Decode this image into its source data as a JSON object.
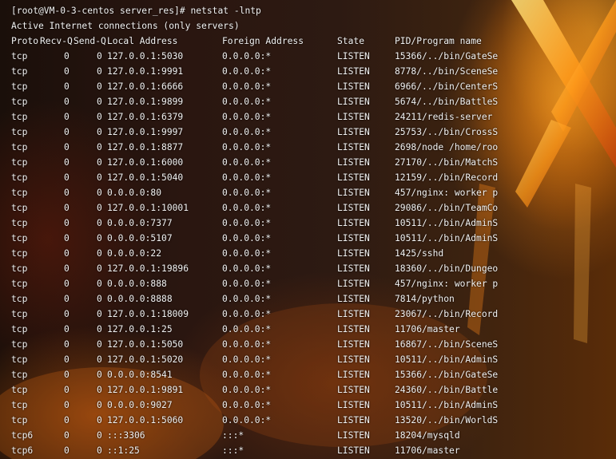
{
  "prompt_line": "[root@VM-0-3-centos server_res]# netstat -lntp",
  "info_line": "Active Internet connections (only servers)",
  "headers": {
    "proto": "Proto",
    "recv": "Recv-Q",
    "send": "Send-Q",
    "local": "Local Address",
    "foreign": "Foreign Address",
    "state": "State",
    "pid": "PID/Program name"
  },
  "rows": [
    {
      "proto": "tcp",
      "recv": "0",
      "send": "0",
      "local": "127.0.0.1:5030",
      "foreign": "0.0.0.0:*",
      "state": "LISTEN",
      "pid": "15366/../bin/GateSe"
    },
    {
      "proto": "tcp",
      "recv": "0",
      "send": "0",
      "local": "127.0.0.1:9991",
      "foreign": "0.0.0.0:*",
      "state": "LISTEN",
      "pid": "8778/../bin/SceneSe"
    },
    {
      "proto": "tcp",
      "recv": "0",
      "send": "0",
      "local": "127.0.0.1:6666",
      "foreign": "0.0.0.0:*",
      "state": "LISTEN",
      "pid": "6966/../bin/CenterS"
    },
    {
      "proto": "tcp",
      "recv": "0",
      "send": "0",
      "local": "127.0.0.1:9899",
      "foreign": "0.0.0.0:*",
      "state": "LISTEN",
      "pid": "5674/../bin/BattleS"
    },
    {
      "proto": "tcp",
      "recv": "0",
      "send": "0",
      "local": "127.0.0.1:6379",
      "foreign": "0.0.0.0:*",
      "state": "LISTEN",
      "pid": "24211/redis-server"
    },
    {
      "proto": "tcp",
      "recv": "0",
      "send": "0",
      "local": "127.0.0.1:9997",
      "foreign": "0.0.0.0:*",
      "state": "LISTEN",
      "pid": "25753/../bin/CrossS"
    },
    {
      "proto": "tcp",
      "recv": "0",
      "send": "0",
      "local": "127.0.0.1:8877",
      "foreign": "0.0.0.0:*",
      "state": "LISTEN",
      "pid": "2698/node /home/roo"
    },
    {
      "proto": "tcp",
      "recv": "0",
      "send": "0",
      "local": "127.0.0.1:6000",
      "foreign": "0.0.0.0:*",
      "state": "LISTEN",
      "pid": "27170/../bin/MatchS"
    },
    {
      "proto": "tcp",
      "recv": "0",
      "send": "0",
      "local": "127.0.0.1:5040",
      "foreign": "0.0.0.0:*",
      "state": "LISTEN",
      "pid": "12159/../bin/Record"
    },
    {
      "proto": "tcp",
      "recv": "0",
      "send": "0",
      "local": "0.0.0.0:80",
      "foreign": "0.0.0.0:*",
      "state": "LISTEN",
      "pid": "457/nginx: worker p"
    },
    {
      "proto": "tcp",
      "recv": "0",
      "send": "0",
      "local": "127.0.0.1:10001",
      "foreign": "0.0.0.0:*",
      "state": "LISTEN",
      "pid": "29086/../bin/TeamCo"
    },
    {
      "proto": "tcp",
      "recv": "0",
      "send": "0",
      "local": "0.0.0.0:7377",
      "foreign": "0.0.0.0:*",
      "state": "LISTEN",
      "pid": "10511/../bin/AdminS"
    },
    {
      "proto": "tcp",
      "recv": "0",
      "send": "0",
      "local": "0.0.0.0:5107",
      "foreign": "0.0.0.0:*",
      "state": "LISTEN",
      "pid": "10511/../bin/AdminS"
    },
    {
      "proto": "tcp",
      "recv": "0",
      "send": "0",
      "local": "0.0.0.0:22",
      "foreign": "0.0.0.0:*",
      "state": "LISTEN",
      "pid": "1425/sshd"
    },
    {
      "proto": "tcp",
      "recv": "0",
      "send": "0",
      "local": "127.0.0.1:19896",
      "foreign": "0.0.0.0:*",
      "state": "LISTEN",
      "pid": "18360/../bin/Dungeo"
    },
    {
      "proto": "tcp",
      "recv": "0",
      "send": "0",
      "local": "0.0.0.0:888",
      "foreign": "0.0.0.0:*",
      "state": "LISTEN",
      "pid": "457/nginx: worker p"
    },
    {
      "proto": "tcp",
      "recv": "0",
      "send": "0",
      "local": "0.0.0.0:8888",
      "foreign": "0.0.0.0:*",
      "state": "LISTEN",
      "pid": "7814/python"
    },
    {
      "proto": "tcp",
      "recv": "0",
      "send": "0",
      "local": "127.0.0.1:18009",
      "foreign": "0.0.0.0:*",
      "state": "LISTEN",
      "pid": "23067/../bin/Record"
    },
    {
      "proto": "tcp",
      "recv": "0",
      "send": "0",
      "local": "127.0.0.1:25",
      "foreign": "0.0.0.0:*",
      "state": "LISTEN",
      "pid": "11706/master"
    },
    {
      "proto": "tcp",
      "recv": "0",
      "send": "0",
      "local": "127.0.0.1:5050",
      "foreign": "0.0.0.0:*",
      "state": "LISTEN",
      "pid": "16867/../bin/SceneS"
    },
    {
      "proto": "tcp",
      "recv": "0",
      "send": "0",
      "local": "127.0.0.1:5020",
      "foreign": "0.0.0.0:*",
      "state": "LISTEN",
      "pid": "10511/../bin/AdminS"
    },
    {
      "proto": "tcp",
      "recv": "0",
      "send": "0",
      "local": "0.0.0.0:8541",
      "foreign": "0.0.0.0:*",
      "state": "LISTEN",
      "pid": "15366/../bin/GateSe"
    },
    {
      "proto": "tcp",
      "recv": "0",
      "send": "0",
      "local": "127.0.0.1:9891",
      "foreign": "0.0.0.0:*",
      "state": "LISTEN",
      "pid": "24360/../bin/Battle"
    },
    {
      "proto": "tcp",
      "recv": "0",
      "send": "0",
      "local": "0.0.0.0:9027",
      "foreign": "0.0.0.0:*",
      "state": "LISTEN",
      "pid": "10511/../bin/AdminS"
    },
    {
      "proto": "tcp",
      "recv": "0",
      "send": "0",
      "local": "127.0.0.1:5060",
      "foreign": "0.0.0.0:*",
      "state": "LISTEN",
      "pid": "13520/../bin/WorldS"
    },
    {
      "proto": "tcp6",
      "recv": "0",
      "send": "0",
      "local": ":::3306",
      "foreign": ":::*",
      "state": "LISTEN",
      "pid": "18204/mysqld"
    },
    {
      "proto": "tcp6",
      "recv": "0",
      "send": "0",
      "local": "::1:25",
      "foreign": ":::*",
      "state": "LISTEN",
      "pid": "11706/master"
    }
  ],
  "colors": {
    "text": "#f2f2f2",
    "fire": "#ff9a1a"
  }
}
